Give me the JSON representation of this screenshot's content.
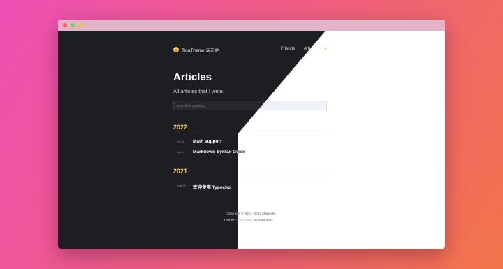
{
  "site": {
    "name": "TinaTheme 演示站"
  },
  "nav": {
    "friends": "Friends",
    "articles": "Articles",
    "theme_icon": "sun-moon-icon"
  },
  "page": {
    "title": "Articles",
    "subtitle": "All articles that I write.",
    "search_placeholder": "Search for anything..."
  },
  "groups": [
    {
      "year": "2022",
      "posts": [
        {
          "date": "Jul 31",
          "title": "Math support"
        },
        {
          "date": "Apr 4",
          "title": "Markdown Syntax Guide"
        }
      ]
    },
    {
      "year": "2021",
      "posts": [
        {
          "date": "Aug 15",
          "title": "欢迎使用 Typecho"
        }
      ]
    }
  ],
  "footer": {
    "copyright": "Copyright © 2021- 2022 Magnetic",
    "theme_label": "Theme:",
    "theme_name": "TinaTheme",
    "by": "By Magnetic"
  },
  "colors": {
    "background_start": "#ec4fb4",
    "background_end": "#f2754a",
    "dark_surface": "#1d1e21",
    "year_accent": "#f2c86b",
    "logo": "#f2c14e"
  }
}
